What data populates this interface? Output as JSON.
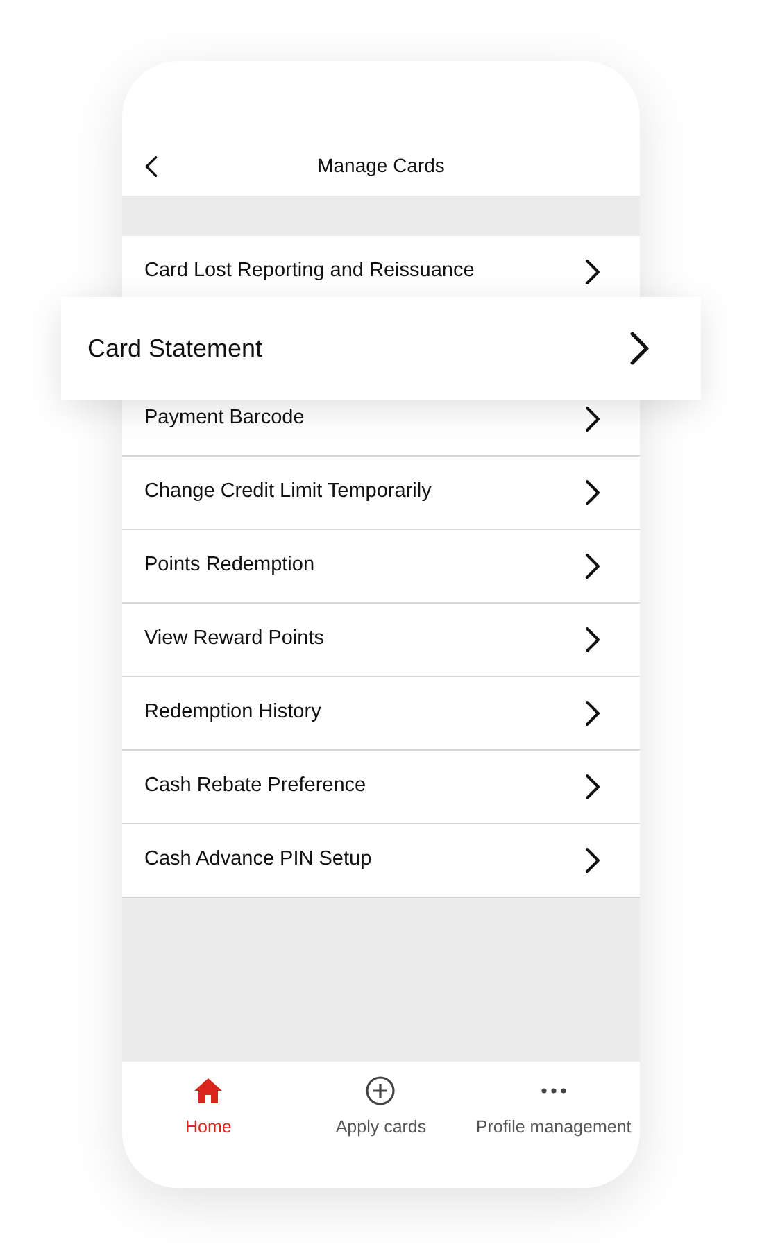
{
  "header": {
    "title": "Manage Cards"
  },
  "menu_items": [
    {
      "label": "Card Lost Reporting and Reissuance",
      "highlighted": false
    },
    {
      "label": "Card Statement",
      "highlighted": true
    },
    {
      "label": "Payment Barcode",
      "highlighted": false
    },
    {
      "label": "Change Credit Limit Temporarily",
      "highlighted": false
    },
    {
      "label": "Points Redemption",
      "highlighted": false
    },
    {
      "label": "View Reward Points",
      "highlighted": false
    },
    {
      "label": "Redemption History",
      "highlighted": false
    },
    {
      "label": "Cash Rebate Preference",
      "highlighted": false
    },
    {
      "label": "Cash Advance PIN Setup",
      "highlighted": false
    }
  ],
  "bottom_nav": [
    {
      "label": "Home",
      "kind": "home",
      "selected": true
    },
    {
      "label": "Apply cards",
      "kind": "add",
      "selected": false
    },
    {
      "label": "Profile management",
      "kind": "more",
      "selected": false
    }
  ]
}
